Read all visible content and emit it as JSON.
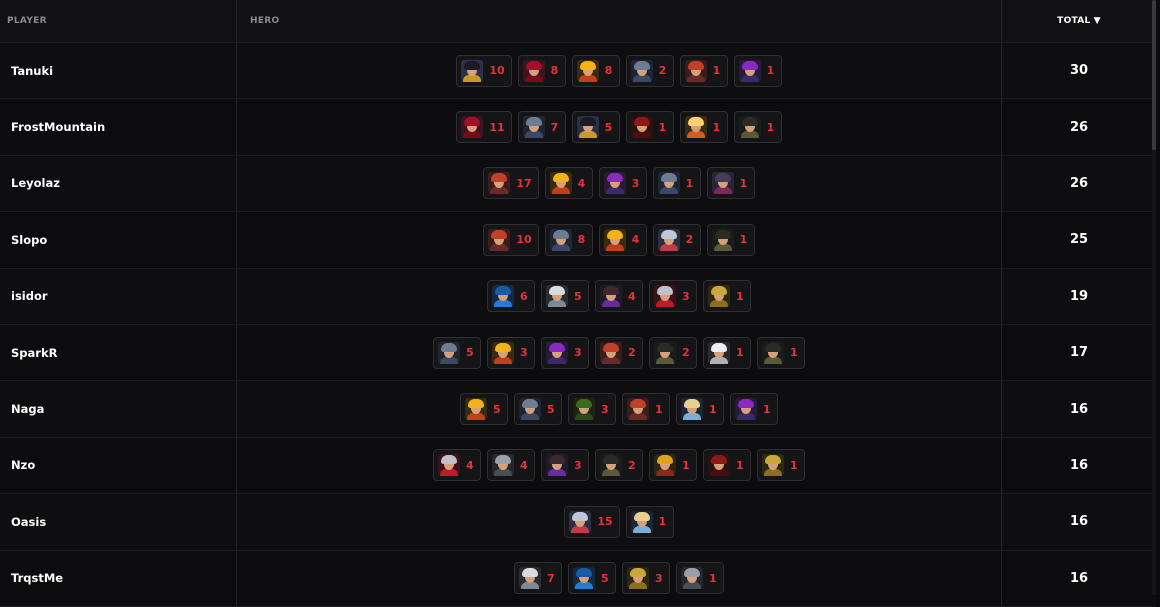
{
  "header": {
    "player_label": "PLAYER",
    "hero_label": "HERO",
    "total_label": "TOTAL",
    "sort_arrow": "▼"
  },
  "colors": {
    "count": "#e2323a",
    "background": "#0b0b0d"
  },
  "heroes": {
    "duelist": {
      "bg": "#2a2f4a",
      "hair": "#1b1b24",
      "body": "#c89a2a"
    },
    "crimson": {
      "bg": "#3a1420",
      "hair": "#a0102a",
      "body": "#7a0a1a"
    },
    "blaze": {
      "bg": "#3a2a10",
      "hair": "#f2b21c",
      "body": "#c0401a"
    },
    "armored": {
      "bg": "#1e2634",
      "hair": "#6e7c92",
      "body": "#3a4a66"
    },
    "redhead": {
      "bg": "#3a1c1c",
      "hair": "#c0402a",
      "body": "#6a2a2a"
    },
    "violet": {
      "bg": "#281a3a",
      "hair": "#8a2ac0",
      "body": "#3a2a6a"
    },
    "hooded": {
      "bg": "#2a1212",
      "hair": "#8a1a1a",
      "body": "#4a0e0e"
    },
    "flame": {
      "bg": "#3a2a12",
      "hair": "#ffd070",
      "body": "#d06020"
    },
    "dark": {
      "bg": "#1a1c1a",
      "hair": "#2a2a26",
      "body": "#5a5a3a"
    },
    "mystic": {
      "bg": "#2a2434",
      "hair": "#4a3a5a",
      "body": "#7a2a5a"
    },
    "astro": {
      "bg": "#2a3040",
      "hair": "#c0c8d8",
      "body": "#c03a4a"
    },
    "blue": {
      "bg": "#122a44",
      "hair": "#1a5aa0",
      "body": "#2a7ad0"
    },
    "silver": {
      "bg": "#2a2c30",
      "hair": "#d8dce2",
      "body": "#7a8a9a"
    },
    "purple": {
      "bg": "#221a2a",
      "hair": "#3a2a2a",
      "body": "#6a2aa0"
    },
    "spider": {
      "bg": "#3a1218",
      "hair": "#c0c0c8",
      "body": "#c01a2a"
    },
    "golden": {
      "bg": "#2e2810",
      "hair": "#c8a83a",
      "body": "#8a7020"
    },
    "ghost": {
      "bg": "#2a2a2e",
      "hair": "#eeeef2",
      "body": "#b0b0b8"
    },
    "horned": {
      "bg": "#1c2414",
      "hair": "#3a6a1a",
      "body": "#2a4a1a"
    },
    "frost": {
      "bg": "#1c2634",
      "hair": "#e8d090",
      "body": "#7ab0d8"
    },
    "winged": {
      "bg": "#2e2410",
      "hair": "#e0a020",
      "body": "#8a2a1a"
    },
    "steel": {
      "bg": "#26282c",
      "hair": "#9aa0aa",
      "body": "#4a4e56"
    }
  },
  "rows": [
    {
      "player": "Tanuki",
      "total": "30",
      "heroes": [
        {
          "icon": "duelist",
          "count": "10"
        },
        {
          "icon": "crimson",
          "count": "8"
        },
        {
          "icon": "blaze",
          "count": "8"
        },
        {
          "icon": "armored",
          "count": "2"
        },
        {
          "icon": "redhead",
          "count": "1"
        },
        {
          "icon": "violet",
          "count": "1"
        }
      ]
    },
    {
      "player": "FrostMountain",
      "total": "26",
      "heroes": [
        {
          "icon": "crimson",
          "count": "11"
        },
        {
          "icon": "armored",
          "count": "7"
        },
        {
          "icon": "duelist",
          "count": "5"
        },
        {
          "icon": "hooded",
          "count": "1"
        },
        {
          "icon": "flame",
          "count": "1"
        },
        {
          "icon": "dark",
          "count": "1"
        }
      ]
    },
    {
      "player": "Leyolaz",
      "total": "26",
      "heroes": [
        {
          "icon": "redhead",
          "count": "17"
        },
        {
          "icon": "blaze",
          "count": "4"
        },
        {
          "icon": "violet",
          "count": "3"
        },
        {
          "icon": "armored",
          "count": "1"
        },
        {
          "icon": "mystic",
          "count": "1"
        }
      ]
    },
    {
      "player": "Slopo",
      "total": "25",
      "heroes": [
        {
          "icon": "redhead",
          "count": "10"
        },
        {
          "icon": "armored",
          "count": "8"
        },
        {
          "icon": "blaze",
          "count": "4"
        },
        {
          "icon": "astro",
          "count": "2"
        },
        {
          "icon": "dark",
          "count": "1"
        }
      ]
    },
    {
      "player": "isidor",
      "total": "19",
      "heroes": [
        {
          "icon": "blue",
          "count": "6"
        },
        {
          "icon": "silver",
          "count": "5"
        },
        {
          "icon": "purple",
          "count": "4"
        },
        {
          "icon": "spider",
          "count": "3"
        },
        {
          "icon": "golden",
          "count": "1"
        }
      ]
    },
    {
      "player": "SparkR",
      "total": "17",
      "heroes": [
        {
          "icon": "armored",
          "count": "5"
        },
        {
          "icon": "blaze",
          "count": "3"
        },
        {
          "icon": "violet",
          "count": "3"
        },
        {
          "icon": "redhead",
          "count": "2"
        },
        {
          "icon": "dark",
          "count": "2"
        },
        {
          "icon": "ghost",
          "count": "1"
        },
        {
          "icon": "dark",
          "count": "1"
        }
      ]
    },
    {
      "player": "Naga",
      "total": "16",
      "heroes": [
        {
          "icon": "blaze",
          "count": "5"
        },
        {
          "icon": "armored",
          "count": "5"
        },
        {
          "icon": "horned",
          "count": "3"
        },
        {
          "icon": "redhead",
          "count": "1"
        },
        {
          "icon": "frost",
          "count": "1"
        },
        {
          "icon": "violet",
          "count": "1"
        }
      ]
    },
    {
      "player": "Nzo",
      "total": "16",
      "heroes": [
        {
          "icon": "spider",
          "count": "4"
        },
        {
          "icon": "steel",
          "count": "4"
        },
        {
          "icon": "purple",
          "count": "3"
        },
        {
          "icon": "dark",
          "count": "2"
        },
        {
          "icon": "winged",
          "count": "1"
        },
        {
          "icon": "hooded",
          "count": "1"
        },
        {
          "icon": "golden",
          "count": "1"
        }
      ]
    },
    {
      "player": "Oasis",
      "total": "16",
      "heroes": [
        {
          "icon": "astro",
          "count": "15"
        },
        {
          "icon": "frost",
          "count": "1"
        }
      ]
    },
    {
      "player": "TrqstMe",
      "total": "16",
      "heroes": [
        {
          "icon": "silver",
          "count": "7"
        },
        {
          "icon": "blue",
          "count": "5"
        },
        {
          "icon": "golden",
          "count": "3"
        },
        {
          "icon": "steel",
          "count": "1"
        }
      ]
    }
  ]
}
